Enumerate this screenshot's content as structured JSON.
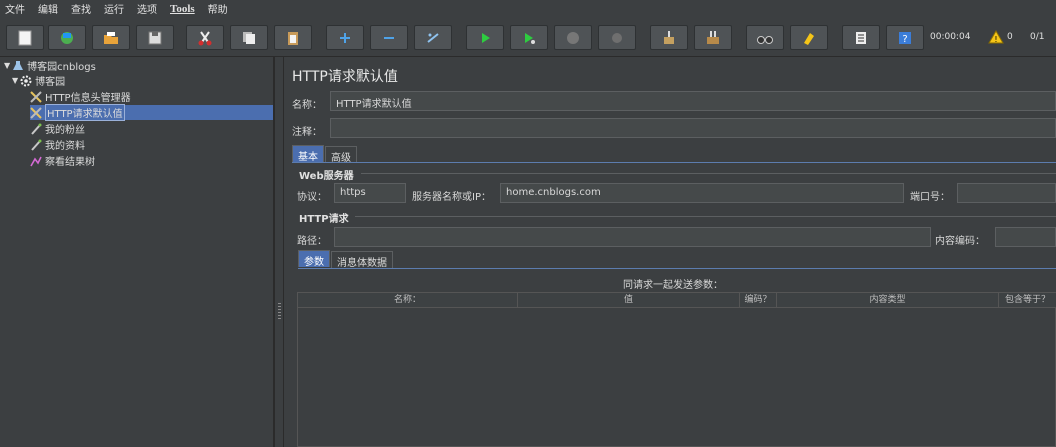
{
  "menu": [
    "文件",
    "编辑",
    "查找",
    "运行",
    "选项",
    "Tools",
    "帮助"
  ],
  "toolbar": {
    "timer": "00:00:04",
    "warnings": "0",
    "threads": "0/1"
  },
  "tree": {
    "root": "博客园cnblogs",
    "group": "博客园",
    "items": [
      "HTTP信息头管理器",
      "HTTP请求默认值",
      "我的粉丝",
      "我的资料",
      "察看结果树"
    ]
  },
  "panel": {
    "title": "HTTP请求默认值",
    "name_label": "名称：",
    "name_value": "HTTP请求默认值",
    "comment_label": "注释：",
    "comment_value": "",
    "tabs": [
      "基本",
      "高级"
    ],
    "web_server": {
      "section": "Web服务器",
      "protocol_label": "协议：",
      "protocol_value": "https",
      "host_label": "服务器名称或IP：",
      "host_value": "home.cnblogs.com",
      "port_label": "端口号：",
      "port_value": ""
    },
    "http_request": {
      "section": "HTTP请求",
      "path_label": "路径：",
      "path_value": "",
      "encoding_label": "内容编码：",
      "encoding_value": ""
    },
    "sub_tabs": [
      "参数",
      "消息体数据"
    ],
    "params_caption": "同请求一起发送参数：",
    "columns": [
      "名称：",
      "值",
      "编码？",
      "内容类型",
      "包含等于？"
    ]
  },
  "colors": {
    "background": "#3c3f41",
    "selection": "#4b6eaf"
  }
}
